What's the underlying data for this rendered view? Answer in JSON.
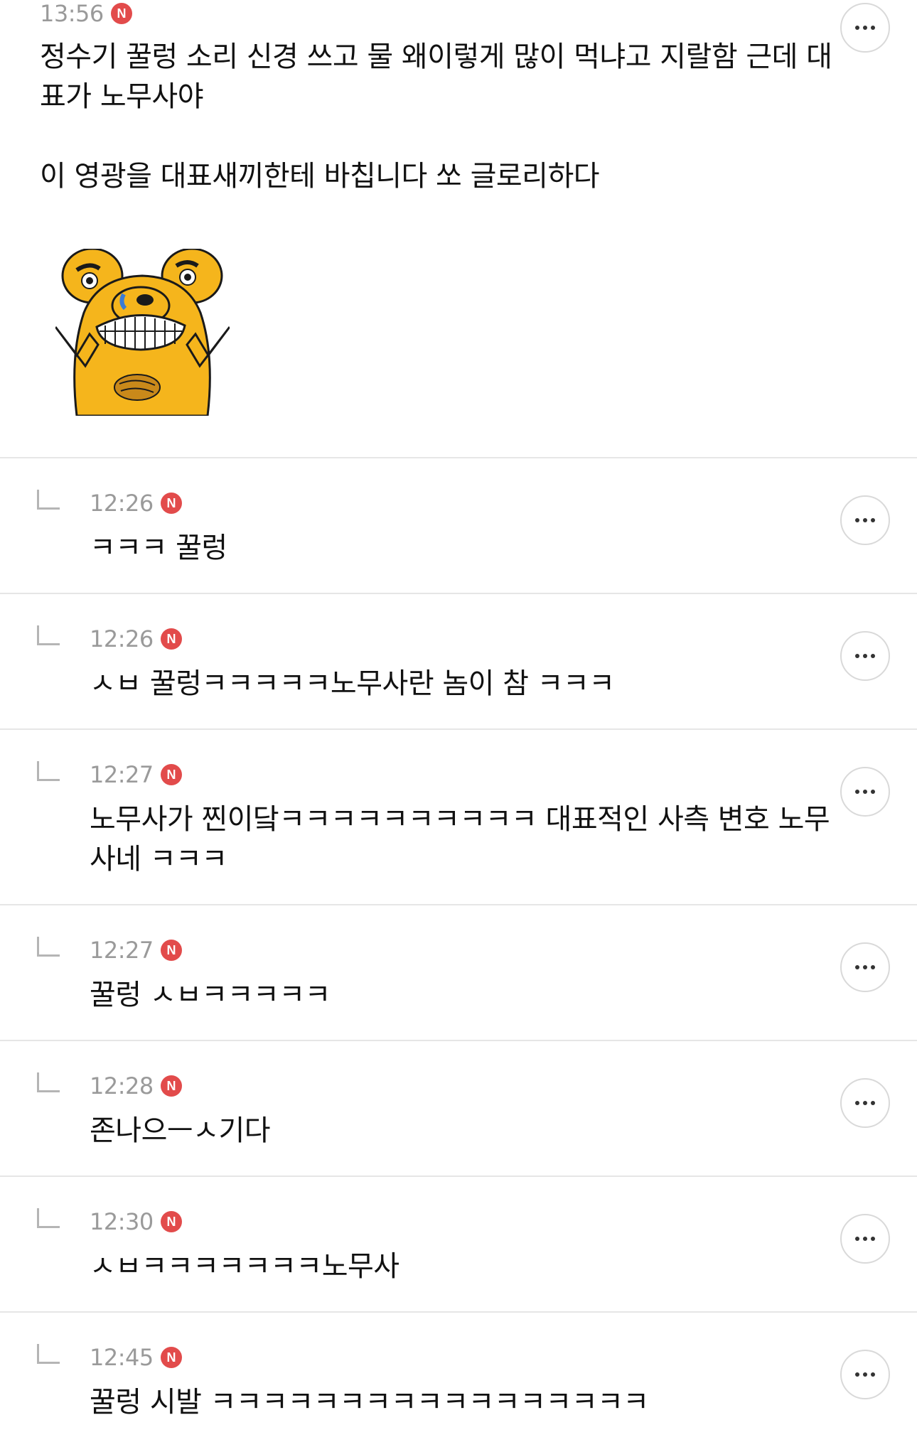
{
  "post": {
    "time": "13:56",
    "badge": "N",
    "text_line1": "정수기 꿀렁 소리 신경 쓰고 물 왜이렇게 많이 먹냐고 지랄함 근데 대표가 노무사야",
    "text_line2": "이 영광을 대표새끼한테 바칩니다 쏘 글로리하다",
    "sticker": "yellow-bear-peace-sign-sticker"
  },
  "replies": [
    {
      "time": "12:26",
      "badge": "N",
      "text": "ㅋㅋㅋ 꿀렁"
    },
    {
      "time": "12:26",
      "badge": "N",
      "text": "ㅅㅂ 꿀렁ㅋㅋㅋㅋㅋ노무사란 놈이 참 ㅋㅋㅋ"
    },
    {
      "time": "12:27",
      "badge": "N",
      "text": "노무사가 찐이닼ㅋㅋㅋㅋㅋㅋㅋㅋㅋㅋ 대표적인 사측 변호 노무사네 ㅋㅋㅋ"
    },
    {
      "time": "12:27",
      "badge": "N",
      "text": "꿀렁 ㅅㅂㅋㅋㅋㅋㅋ"
    },
    {
      "time": "12:28",
      "badge": "N",
      "text": "존나으ㅡㅅ기다"
    },
    {
      "time": "12:30",
      "badge": "N",
      "text": "ㅅㅂㅋㅋㅋㅋㅋㅋㅋ노무사"
    },
    {
      "time": "12:45",
      "badge": "N",
      "text": "꿀렁 시발 ㅋㅋㅋㅋㅋㅋㅋㅋㅋㅋㅋㅋㅋㅋㅋㅋㅋ"
    }
  ],
  "icons": {
    "more": "more-options-icon",
    "reply": "reply-arrow-icon",
    "new": "new-badge-icon"
  },
  "colors": {
    "badge": "#e24b4b",
    "meta_text": "#9a9a9a",
    "divider": "#e6e6e6",
    "sticker_yellow": "#f5b51c"
  }
}
